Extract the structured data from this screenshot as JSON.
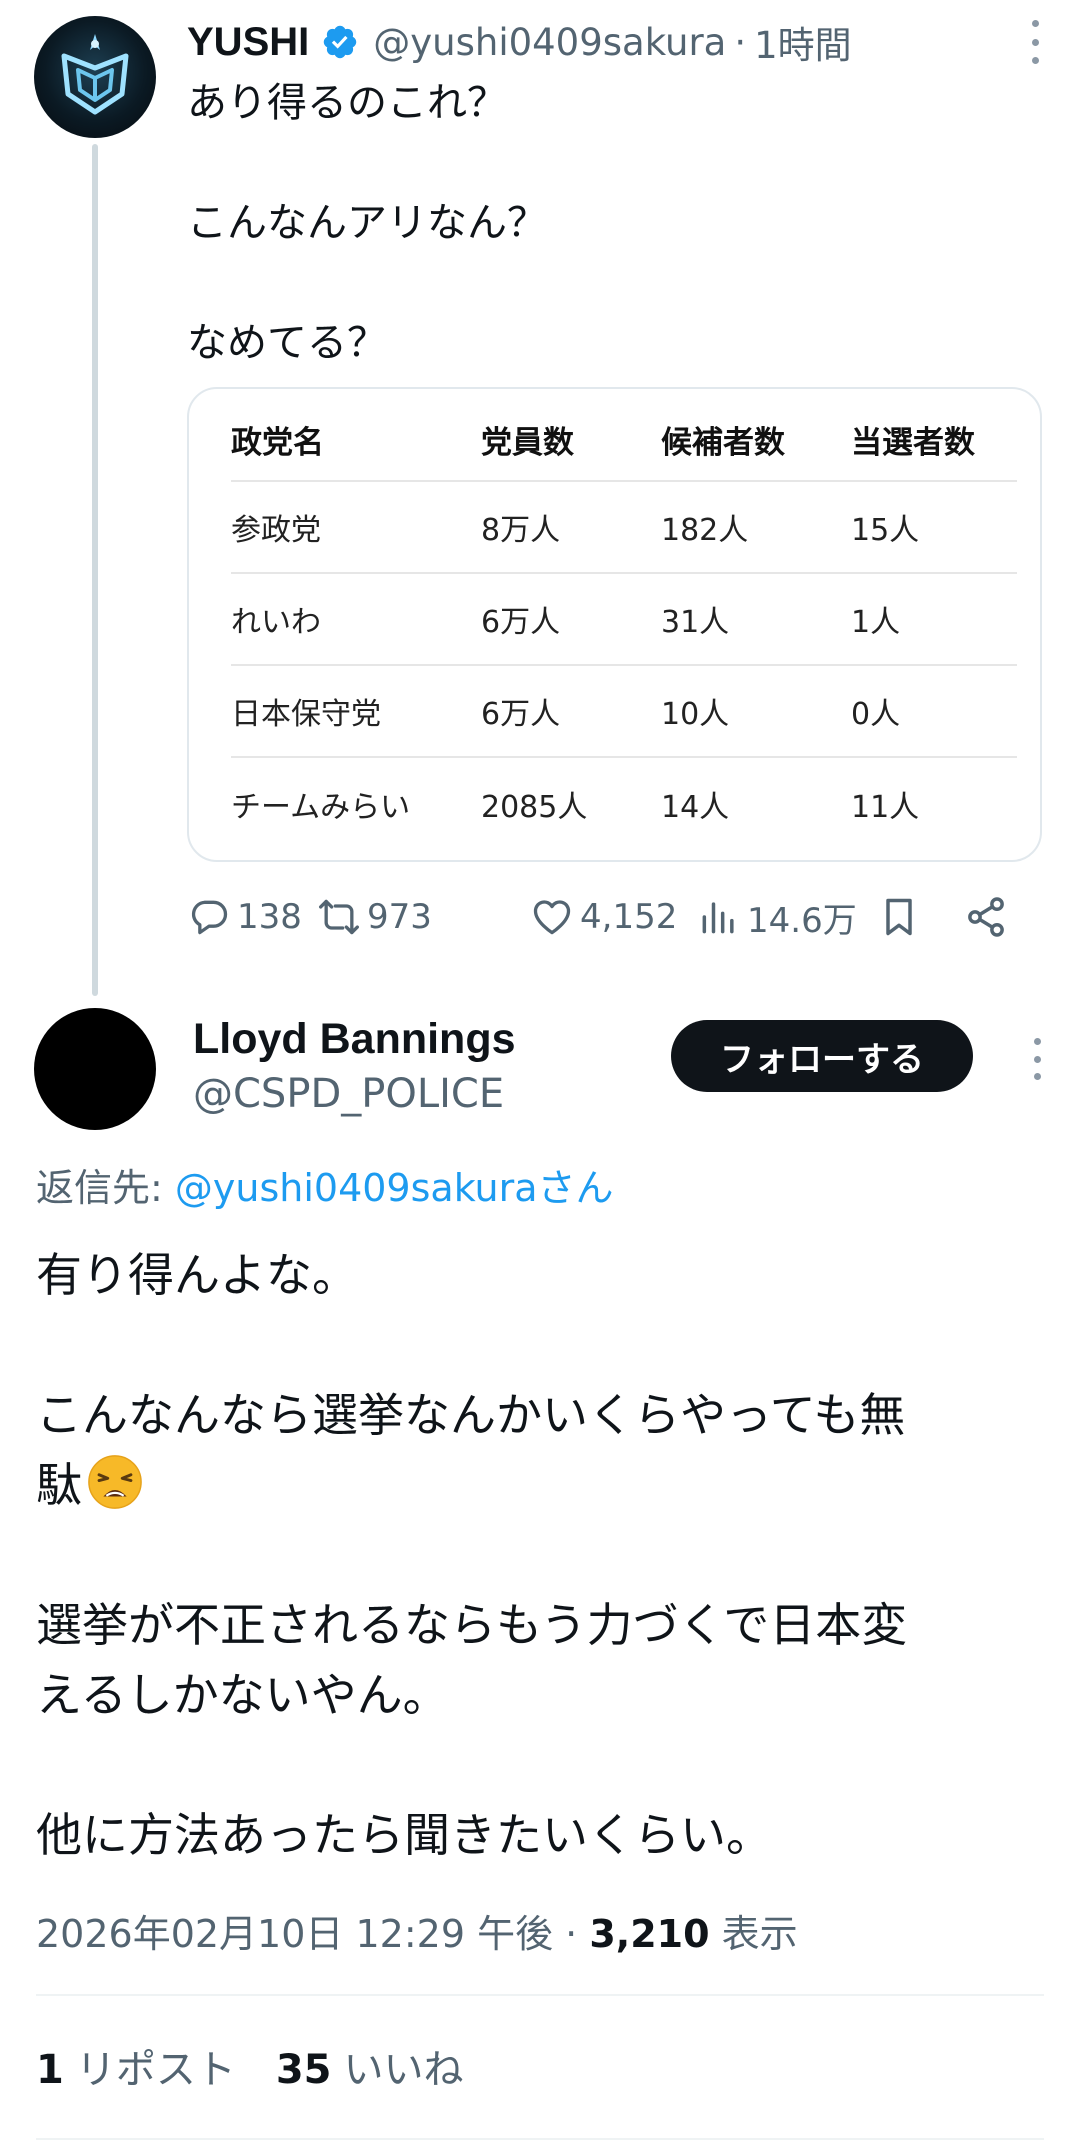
{
  "parent_tweet": {
    "display_name": "YUSHI",
    "handle": "@yushi0409sakura",
    "separator": "·",
    "time": "1時間",
    "text_lines": [
      "あり得るのこれ？",
      "こんなんアリなん？",
      "なめてる？"
    ],
    "table": {
      "headers": [
        "政党名",
        "党員数",
        "候補者数",
        "当選者数"
      ],
      "rows": [
        [
          "参政党",
          "8万人",
          "182人",
          "15人"
        ],
        [
          "れいわ",
          "6万人",
          "31人",
          "1人"
        ],
        [
          "日本保守党",
          "6万人",
          "10人",
          "0人"
        ],
        [
          "チームみらい",
          "2085人",
          "14人",
          "11人"
        ]
      ]
    },
    "actions": {
      "replies": "138",
      "retweets": "973",
      "likes": "4,152",
      "views": "14.6万"
    }
  },
  "reply_tweet": {
    "display_name": "Lloyd Bannings",
    "handle": "@CSPD_POLICE",
    "follow_label": "フォローする",
    "reply_to_prefix": "返信先: ",
    "reply_to_link": "@yushi0409sakuraさん",
    "paragraphs": [
      [
        "有り得んよな。"
      ],
      [
        "こんなんなら選挙なんかいくらやっても無",
        "駄"
      ],
      [
        "選挙が不正されるならもう力づくで日本変",
        "えるしかないやん。"
      ],
      [
        "他に方法あったら聞きたいくらい。"
      ]
    ],
    "emoji": "weary-face",
    "timestamp": "2026年02月10日 12:29 午後",
    "meta_separator": " · ",
    "views_count": "3,210",
    "views_label": " 表示",
    "repost_count": "1",
    "repost_label": "リポスト",
    "like_count": "35",
    "like_label": "いいね"
  },
  "colors": {
    "text_primary": "#0f1419",
    "text_secondary": "#536471",
    "link": "#1d9bf0",
    "verified": "#1d9bf0",
    "thread_line": "#cfd9de",
    "follow_button_bg": "#0f1419"
  }
}
